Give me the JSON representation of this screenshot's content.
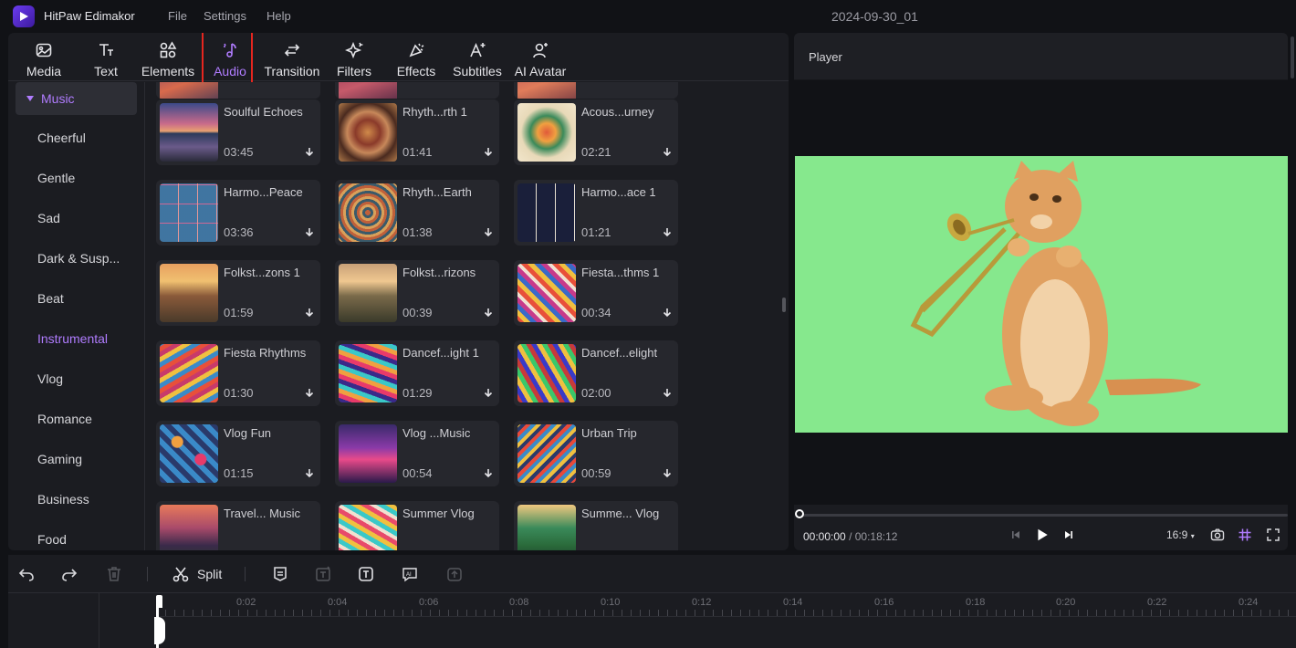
{
  "app": {
    "name": "HitPaw Edimakor",
    "project_title": "2024-09-30_01",
    "menu": [
      "File",
      "Settings",
      "Help"
    ]
  },
  "toolbar": {
    "items": [
      {
        "label": "Media",
        "icon": "media-icon"
      },
      {
        "label": "Text",
        "icon": "text-icon"
      },
      {
        "label": "Elements",
        "icon": "elements-icon"
      },
      {
        "label": "Audio",
        "icon": "audio-icon",
        "active": true
      },
      {
        "label": "Transition",
        "icon": "transition-icon"
      },
      {
        "label": "Filters",
        "icon": "filters-icon"
      },
      {
        "label": "Effects",
        "icon": "effects-icon"
      },
      {
        "label": "Subtitles",
        "icon": "subtitles-icon"
      },
      {
        "label": "AI Avatar",
        "icon": "ai-avatar-icon"
      }
    ]
  },
  "categories": {
    "items": [
      "Music",
      "Cheerful",
      "Gentle",
      "Sad",
      "Dark & Susp...",
      "Beat",
      "Instrumental",
      "Vlog",
      "Romance",
      "Gaming",
      "Business",
      "Food"
    ],
    "selected": "Music",
    "highlighted": "Instrumental"
  },
  "tracks": [
    {
      "title": "Soulful Echoes",
      "duration": "03:45"
    },
    {
      "title": "Rhyth...rth 1",
      "duration": "01:41"
    },
    {
      "title": "Acous...urney",
      "duration": "02:21"
    },
    {
      "title": "Harmo...Peace",
      "duration": "03:36"
    },
    {
      "title": "Rhyth...Earth",
      "duration": "01:38"
    },
    {
      "title": "Harmo...ace 1",
      "duration": "01:21"
    },
    {
      "title": "Folkst...zons 1",
      "duration": "01:59"
    },
    {
      "title": "Folkst...rizons",
      "duration": "00:39"
    },
    {
      "title": "Fiesta...thms 1",
      "duration": "00:34"
    },
    {
      "title": "Fiesta Rhythms",
      "duration": "01:30"
    },
    {
      "title": "Dancef...ight 1",
      "duration": "01:29"
    },
    {
      "title": "Dancef...elight",
      "duration": "02:00"
    },
    {
      "title": "Vlog Fun",
      "duration": "01:15"
    },
    {
      "title": "Vlog ...Music",
      "duration": "00:54"
    },
    {
      "title": "Urban Trip",
      "duration": "00:59"
    },
    {
      "title": "Travel... Music",
      "duration": ""
    },
    {
      "title": "Summer Vlog",
      "duration": ""
    },
    {
      "title": "Summe... Vlog",
      "duration": ""
    }
  ],
  "player": {
    "title": "Player",
    "current_time": "00:00:00",
    "separator": "/",
    "total_time": "00:18:12",
    "aspect_ratio": "16:9",
    "progress": 0,
    "background_color": "#86e88d"
  },
  "timeline": {
    "split_label": "Split",
    "ticks": [
      "0:02",
      "0:04",
      "0:06",
      "0:08",
      "0:10",
      "0:12",
      "0:14",
      "0:16",
      "0:18",
      "0:20",
      "0:22",
      "0:24"
    ]
  },
  "colors": {
    "accent": "#b07cff",
    "highlight_box": "#e5261f",
    "panel": "#1b1c21",
    "background": "#111216"
  }
}
